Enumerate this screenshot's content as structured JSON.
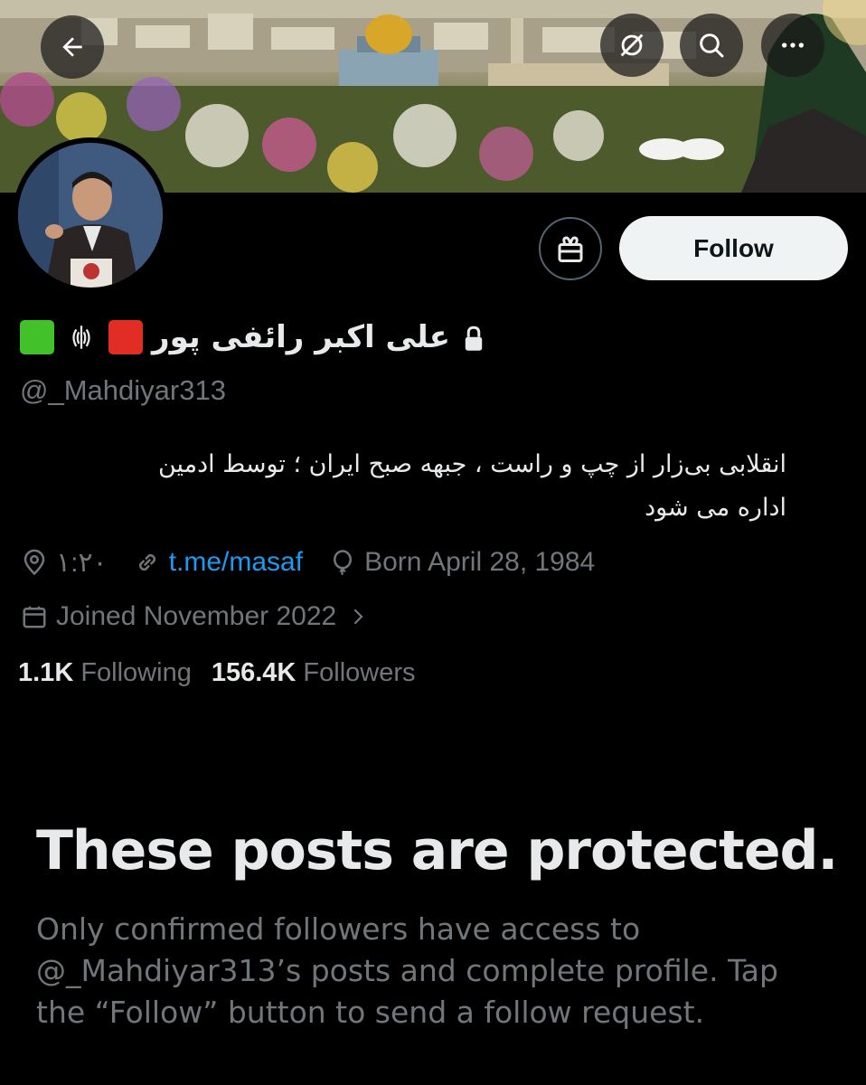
{
  "header": {
    "back_icon": "arrow-left-icon",
    "refresh_icon": "refresh-off-icon",
    "search_icon": "search-icon",
    "more_icon": "more-horizontal-icon"
  },
  "profile": {
    "display_name": "علی اکبر رائفی پور",
    "name_prefix_emoji": [
      "green-square",
      "iran-emblem",
      "red-square"
    ],
    "protected_icon": "lock-icon",
    "handle": "@_Mahdiyar313",
    "bio_line1": "انقلابی بی‌زار از چپ و راست ، جبهه صبح ایران ؛ توسط ادمین",
    "bio_line2": "اداره می شود",
    "location": "۱:۲۰",
    "link": "t.me/masaf",
    "birth": "Born April 28, 1984",
    "joined": "Joined November 2022",
    "following_count": "1.1K",
    "following_label": "Following",
    "followers_count": "156.4K",
    "followers_label": "Followers"
  },
  "actions": {
    "follow_label": "Follow",
    "gift_icon": "gift-icon"
  },
  "protected_notice": {
    "title": "These posts are protected.",
    "text": "Only confirmed followers have access to @_Mahdiyar313’s posts and complete profile. Tap the “Follow” button to send a follow request."
  },
  "colors": {
    "background": "#000000",
    "primary_text": "#e7e9ea",
    "secondary_text": "#71767b",
    "link": "#1d9bf0",
    "follow_button_bg": "#eff3f4"
  }
}
